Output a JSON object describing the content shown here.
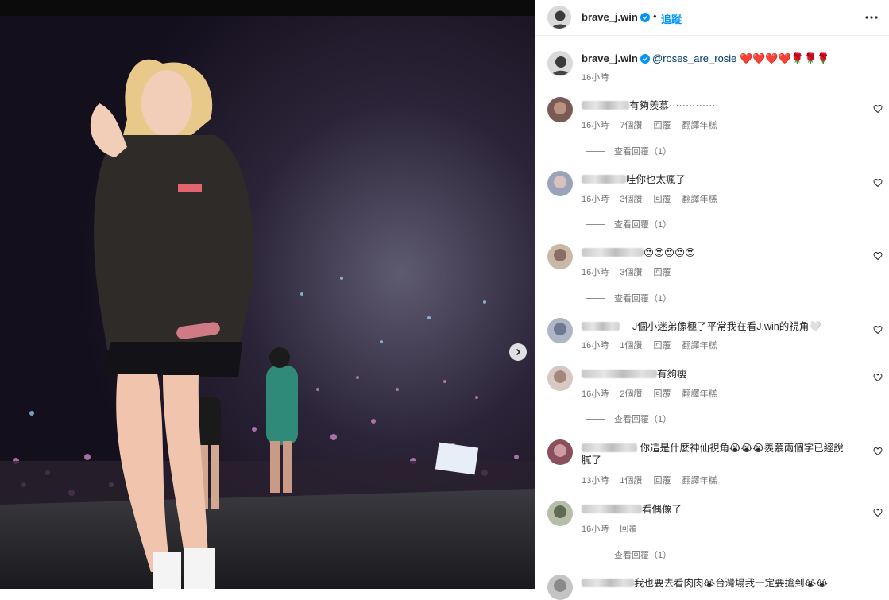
{
  "post": {
    "username": "brave_j.win",
    "follow_label": "追蹤",
    "caption_mention": "@roses_are_rosie",
    "caption_emojis": "❤️❤️❤️❤️🌹🌹🌹",
    "caption_time": "16小時"
  },
  "comments": [
    {
      "text": "有夠羨慕⋯⋯⋯⋯⋯",
      "time": "16小時",
      "likes": "7個讚",
      "reply": "回覆",
      "translate": "翻譯年糕",
      "view_replies": "查看回覆（1）"
    },
    {
      "text": "哇你也太瘋了",
      "time": "16小時",
      "likes": "3個讚",
      "reply": "回覆",
      "translate": "翻譯年糕",
      "view_replies": "查看回覆（1）"
    },
    {
      "text": "😍😍😍😍😍",
      "time": "16小時",
      "likes": "3個讚",
      "reply": "回覆",
      "translate": "",
      "view_replies": "查看回覆（1）"
    },
    {
      "text": "＿J個小迷弟像極了平常我在看J.win的視角🤍",
      "time": "16小時",
      "likes": "1個讚",
      "reply": "回覆",
      "translate": "翻譯年糕",
      "view_replies": ""
    },
    {
      "text": "有夠瘦",
      "time": "16小時",
      "likes": "2個讚",
      "reply": "回覆",
      "translate": "翻譯年糕",
      "view_replies": "查看回覆（1）"
    },
    {
      "text": "你這是什麼神仙視角😭😭😭羨慕兩個字已經說膩了",
      "time": "13小時",
      "likes": "1個讚",
      "reply": "回覆",
      "translate": "翻譯年糕",
      "view_replies": ""
    },
    {
      "text": "看偶像了",
      "time": "16小時",
      "likes": "",
      "reply": "回覆",
      "translate": "",
      "view_replies": "查看回覆（1）"
    },
    {
      "text": "我也要去看肉肉😭台灣場我一定要搶到😭😭",
      "time": "",
      "likes": "",
      "reply": "",
      "translate": "",
      "view_replies": ""
    }
  ],
  "colors": {
    "link": "#0095f6",
    "mention": "#00376b",
    "meta": "#737373"
  }
}
